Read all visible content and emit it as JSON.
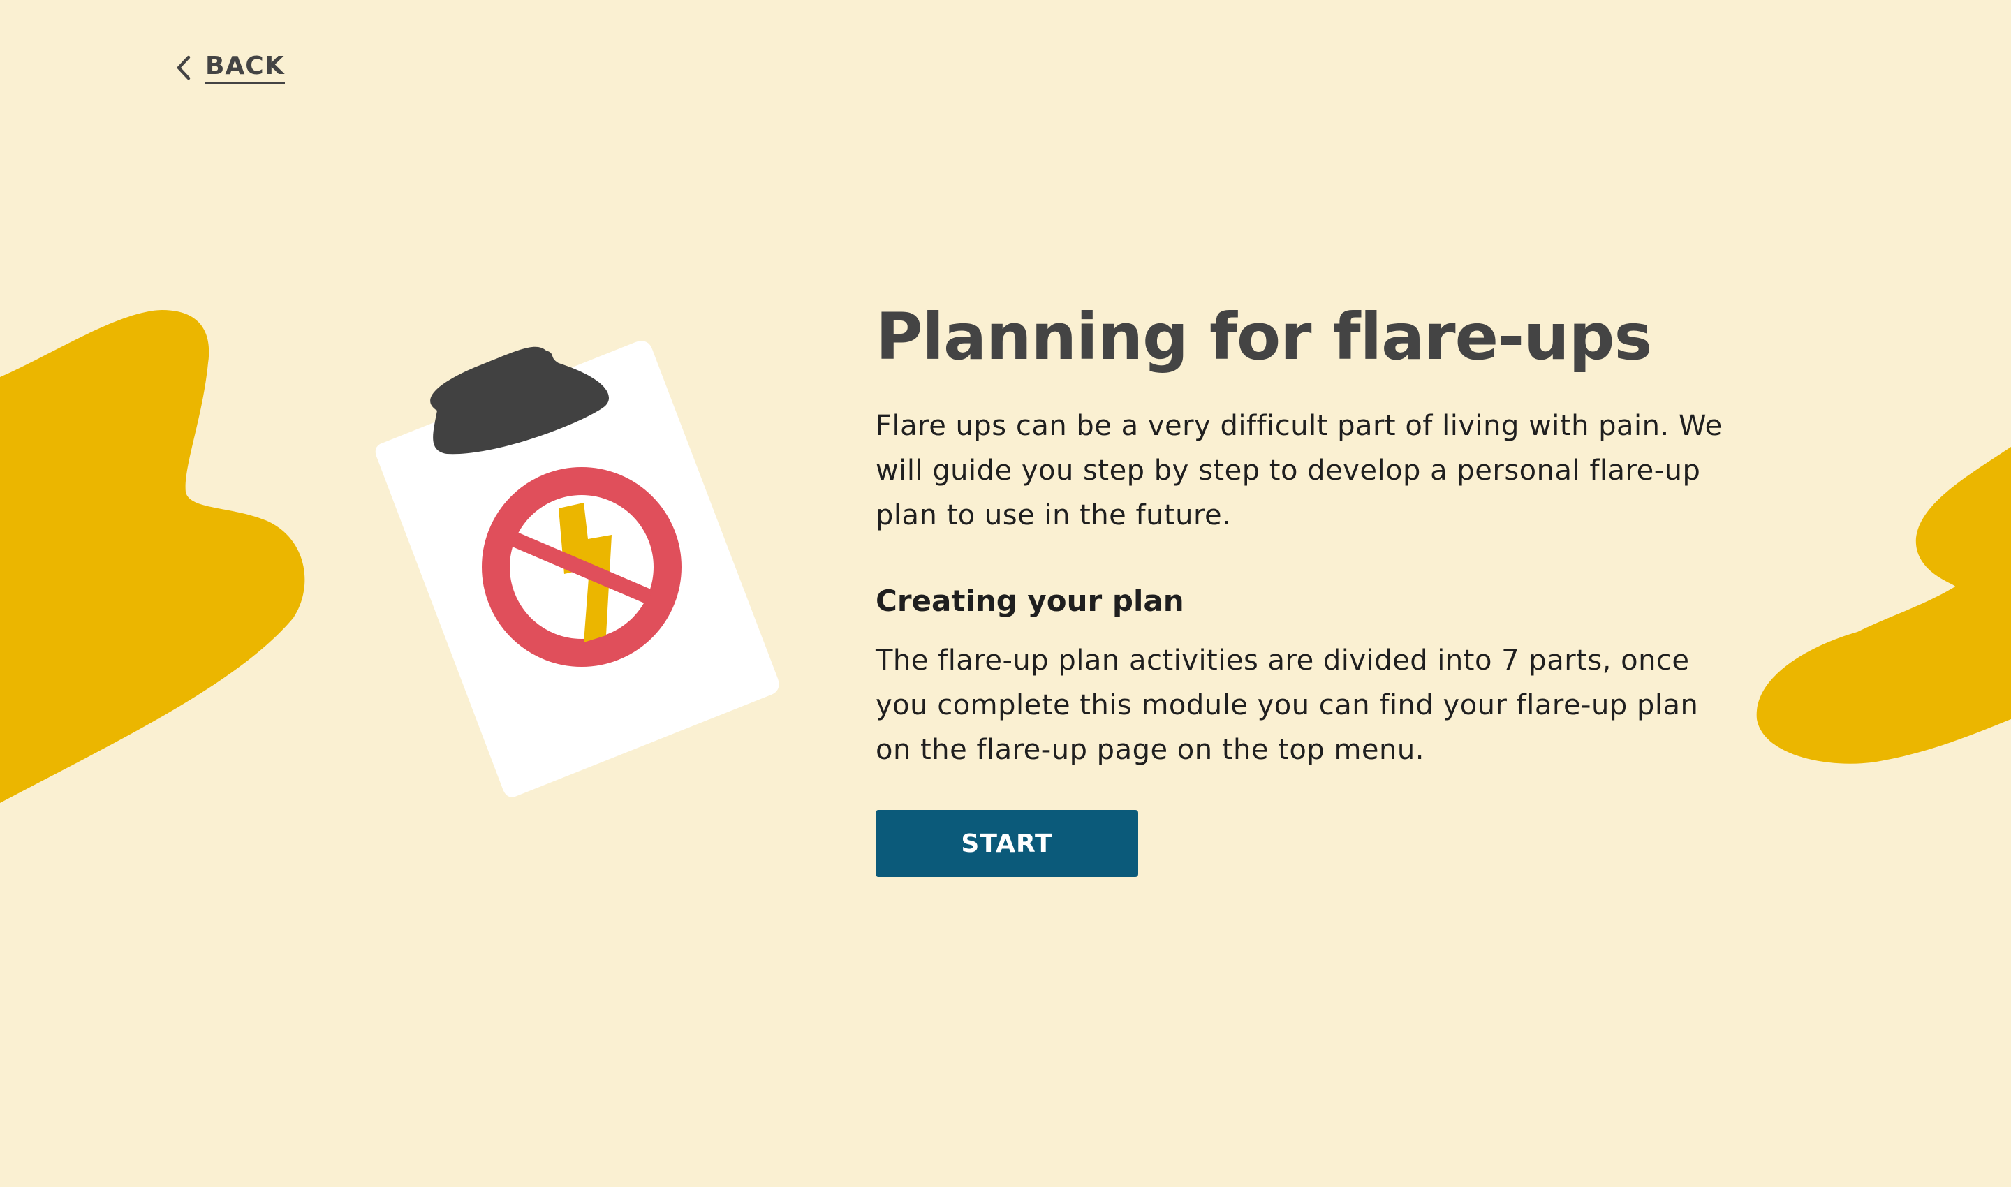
{
  "nav": {
    "back_label": "BACK",
    "back_icon": "chevron-left-icon"
  },
  "main": {
    "title": "Planning for flare-ups",
    "intro": "Flare ups can be a very difficult part of living with pain. We will guide you step by step to develop a personal flare-up plan to use in the future.",
    "section_heading": "Creating your plan",
    "section_text": "The flare-up plan activities are divided into 7 parts, once you complete this module you can find your flare-up plan on the flare-up page on the top menu.",
    "start_label": "START"
  },
  "illustration": {
    "icon": "clipboard-no-flare-icon"
  },
  "colors": {
    "background": "#faf0d2",
    "accent_yellow": "#ebb600",
    "button": "#0b5a7a",
    "title_text": "#444444",
    "body_text": "#1f1f1f",
    "prohibition_red": "#e04f5b",
    "clip_dark": "#414141"
  }
}
